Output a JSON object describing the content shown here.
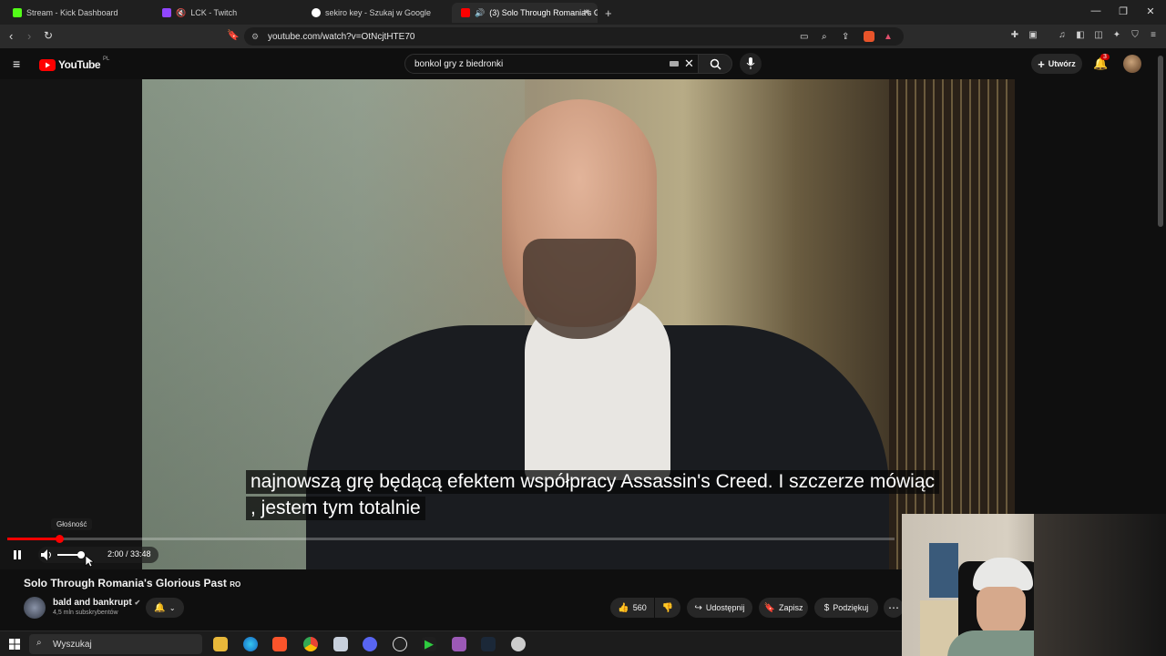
{
  "browser": {
    "tabs": [
      {
        "label": "Stream - Kick Dashboard",
        "color": "#53fc18"
      },
      {
        "label": "LCK - Twitch",
        "color": "#9146ff"
      },
      {
        "label": "sekiro key - Szukaj w Google",
        "color": "#ffffff"
      },
      {
        "label": "(3) Solo Through Romania's G",
        "color": "#ff0000"
      }
    ],
    "url": "youtube.com/watch?v=OtNcjtHTE70"
  },
  "youtube": {
    "logo_text": "YouTube",
    "region": "PL",
    "search_value": "bonkol gry z biedronki",
    "create_label": "Utwórz",
    "notif_count": "3"
  },
  "player": {
    "caption_line1": "najnowszą grę będącą efektem współpracy Assassin's Creed.  I szczerze mówiąc",
    "caption_line2": ", jestem tym totalnie",
    "volume_tooltip": "Głośność",
    "time_display": "2:00 / 33:48",
    "progress_fraction": 0.059,
    "volume_fraction": 0.85
  },
  "video": {
    "title": "Solo Through Romania's Glorious Past",
    "title_badge": "RO",
    "channel_name": "bald and bankrupt",
    "subscribers": "4,5 mln subskrybentów",
    "like_count": "560",
    "share_label": "Udostępnij",
    "save_label": "Zapisz",
    "thanks_label": "Podziękuj"
  },
  "taskbar": {
    "search_placeholder": "Wyszukaj"
  }
}
